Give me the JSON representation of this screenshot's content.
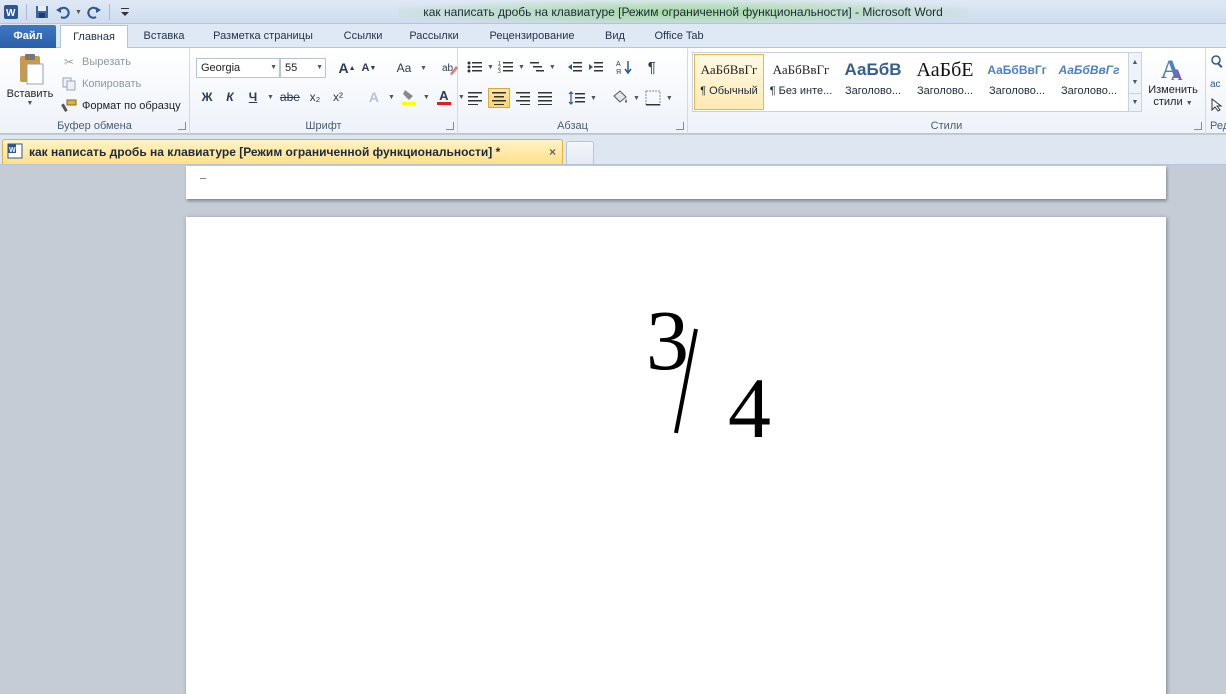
{
  "window": {
    "title": "как написать дробь на клавиатуре [Режим ограниченной функциональности]  -  Microsoft Word"
  },
  "ribbon_tabs": [
    {
      "label": "Файл"
    },
    {
      "label": "Главная"
    },
    {
      "label": "Вставка"
    },
    {
      "label": "Разметка страницы"
    },
    {
      "label": "Ссылки"
    },
    {
      "label": "Рассылки"
    },
    {
      "label": "Рецензирование"
    },
    {
      "label": "Вид"
    },
    {
      "label": "Office Tab"
    }
  ],
  "clipboard": {
    "paste_label": "Вставить",
    "cut_label": "Вырезать",
    "copy_label": "Копировать",
    "format_painter_label": "Формат по образцу",
    "group_label": "Буфер обмена"
  },
  "font": {
    "family_value": "Georgia",
    "size_value": "55",
    "change_case_label": "Aa",
    "bold_label": "Ж",
    "italic_label": "К",
    "underline_label": "Ч",
    "strike_label": "abe",
    "subscript_label": "x₂",
    "superscript_label": "x²",
    "grow_label": "A",
    "shrink_label": "A",
    "font_color_label": "A",
    "group_label": "Шрифт"
  },
  "paragraph": {
    "pilcrow_label": "¶",
    "group_label": "Абзац"
  },
  "styles": {
    "items": [
      {
        "sample": "АаБбВвГг",
        "name": "¶ Обычный"
      },
      {
        "sample": "АаБбВвГг",
        "name": "¶ Без инте..."
      },
      {
        "sample": "АаБбВ",
        "name": "Заголово..."
      },
      {
        "sample": "АаБбЕ",
        "name": "Заголово..."
      },
      {
        "sample": "АаБбВвГг",
        "name": "Заголово..."
      },
      {
        "sample": "АаБбВвГг",
        "name": "Заголово..."
      }
    ],
    "change_styles_label_1": "Изменить",
    "change_styles_label_2": "стили",
    "group_label": "Стили"
  },
  "editing": {
    "group_label": "Ред"
  },
  "document_tab": {
    "label": "как написать дробь на клавиатуре [Режим ограниченной функциональности] *",
    "close": "×"
  },
  "document": {
    "numerator": "3",
    "denominator": "4"
  },
  "colors": {
    "file_tab": "#2a5fa8",
    "highlight": "#ffff00",
    "font_color": "#e02020",
    "active_doc_tab": "#ffe08a"
  }
}
